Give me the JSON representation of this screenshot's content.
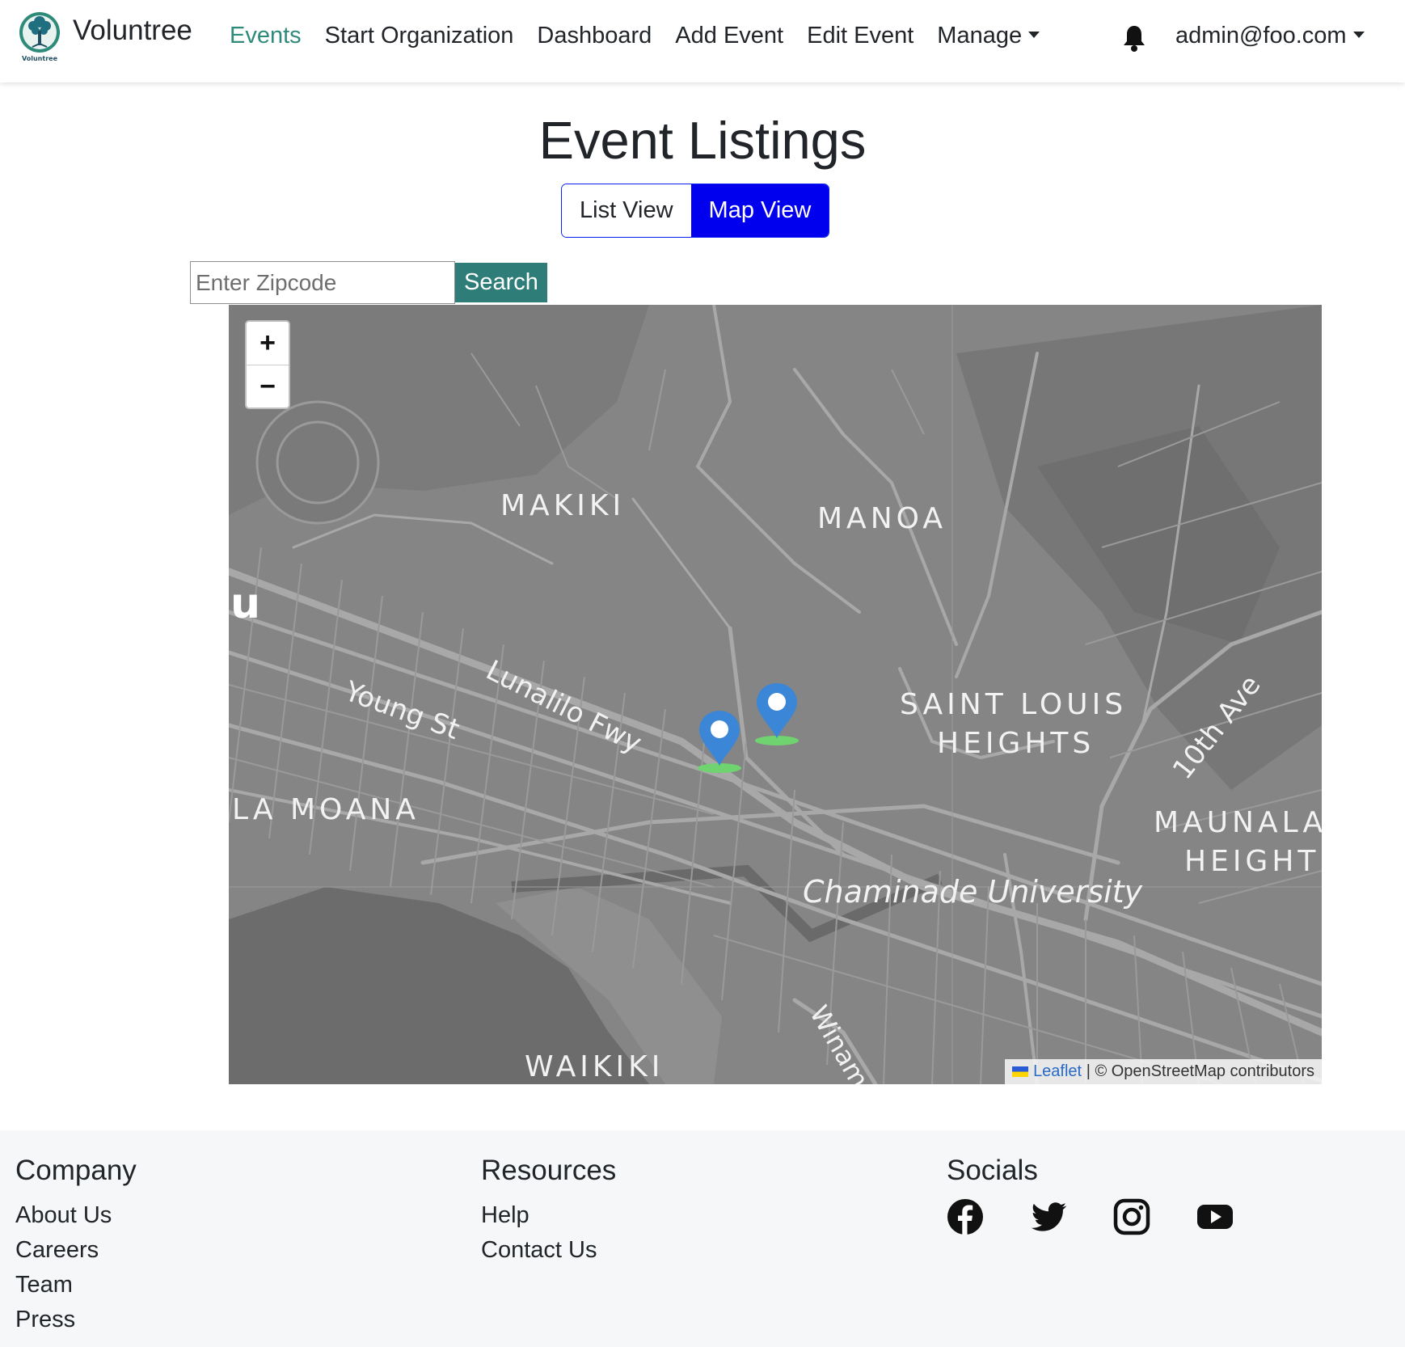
{
  "nav": {
    "brand": "Voluntree",
    "logo_text": "Voluntree",
    "links": [
      "Events",
      "Start Organization",
      "Dashboard",
      "Add Event",
      "Edit Event",
      "Manage"
    ],
    "active": "Events",
    "user": "admin@foo.com"
  },
  "page": {
    "title": "Event Listings",
    "view_toggle": {
      "list": "List View",
      "map": "Map View",
      "selected": "Map View"
    },
    "zip_placeholder": "Enter Zipcode",
    "search_label": "Search"
  },
  "map": {
    "zoom_in": "+",
    "zoom_out": "−",
    "labels": [
      "MAKIKI",
      "MANOA",
      "u",
      "Young St",
      "Lunalilo Fwy",
      "SAINT LOUIS",
      "HEIGHTS",
      "10th Ave",
      "LA MOANA",
      "MAUNALA",
      "HEIGHT",
      "Chaminade University",
      "Winam",
      "WAIKIKI"
    ],
    "marker_count": 2,
    "attribution": {
      "leaflet": "Leaflet",
      "separator": "|",
      "osm": "© OpenStreetMap contributors"
    },
    "colors": {
      "base": "#858585",
      "marker": "#3b86d6",
      "marker_shadow": "#6fd46f"
    }
  },
  "footer": {
    "company": {
      "heading": "Company",
      "links": [
        "About Us",
        "Careers",
        "Team",
        "Press"
      ]
    },
    "resources": {
      "heading": "Resources",
      "links": [
        "Help",
        "Contact Us"
      ]
    },
    "socials": {
      "heading": "Socials",
      "icons": [
        "facebook-icon",
        "twitter-icon",
        "instagram-icon",
        "youtube-icon"
      ]
    }
  }
}
